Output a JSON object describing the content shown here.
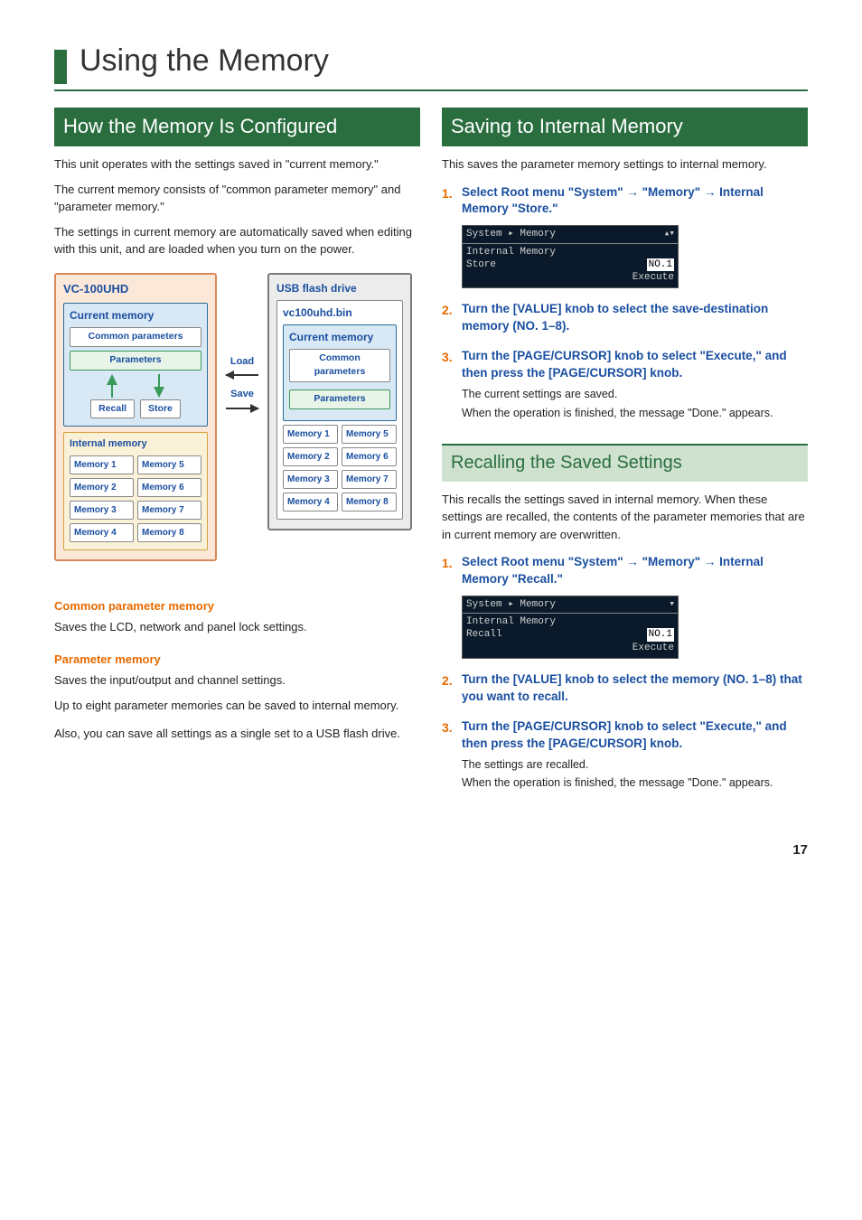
{
  "page_title": "Using the Memory",
  "page_number": "17",
  "left": {
    "heading": "How the Memory Is Configured",
    "p1": "This unit operates with the settings saved in \"current memory.\"",
    "p2": "The current memory consists of \"common parameter memory\" and \"parameter memory.\"",
    "p3": "The settings in current memory are automatically saved when editing with this unit, and are loaded when you turn on the power.",
    "diagram": {
      "vc_title": "VC-100UHD",
      "cur_mem": "Current memory",
      "common": "Common parameters",
      "params": "Parameters",
      "recall": "Recall",
      "store": "Store",
      "int_mem": "Internal memory",
      "mems": [
        "Memory 1",
        "Memory 2",
        "Memory 3",
        "Memory 4",
        "Memory 5",
        "Memory 6",
        "Memory 7",
        "Memory 8"
      ],
      "load": "Load",
      "save": "Save",
      "usb": "USB flash drive",
      "file": "vc100uhd.bin"
    },
    "cpm_head": "Common parameter memory",
    "cpm_body": "Saves the LCD, network and panel lock settings.",
    "pm_head": "Parameter memory",
    "pm_body1": "Saves the input/output and channel settings.",
    "pm_body2": "Up to eight parameter memories can be saved to internal memory.",
    "pm_body3": "Also, you can save all settings as a single set to a USB flash drive."
  },
  "right": {
    "save_head": "Saving to Internal Memory",
    "save_intro": "This saves the parameter memory settings to internal memory.",
    "save_steps": {
      "s1": "Select Root menu \"System\" → \"Memory\" → Internal Memory \"Store.\"",
      "s2": "Turn the [VALUE] knob to select the save-destination memory (NO. 1–8).",
      "s3": "Turn the [PAGE/CURSOR] knob to select \"Execute,\" and then press the [PAGE/CURSOR] knob.",
      "s3a": "The current settings are saved.",
      "s3b": "When the operation is finished, the message \"Done.\" appears."
    },
    "lcd_store": {
      "top": "System ▸ Memory",
      "line1": "Internal Memory",
      "line2": "Store",
      "no": "NO.1",
      "exec": "Execute"
    },
    "recall_head": "Recalling the Saved Settings",
    "recall_intro": "This recalls the settings saved in internal memory. When these settings are recalled, the contents of the parameter memories that are in current memory are overwritten.",
    "recall_steps": {
      "s1": "Select Root menu \"System\" → \"Memory\" → Internal Memory \"Recall.\"",
      "s2": "Turn the [VALUE] knob to select the memory (NO. 1–8) that you want to recall.",
      "s3": "Turn the [PAGE/CURSOR] knob to select \"Execute,\" and then press the [PAGE/CURSOR] knob.",
      "s3a": "The settings are recalled.",
      "s3b": "When the operation is finished, the message \"Done.\" appears."
    },
    "lcd_recall": {
      "top": "System ▸ Memory",
      "line1": "Internal Memory",
      "line2": "Recall",
      "no": "NO.1",
      "exec": "Execute"
    }
  }
}
